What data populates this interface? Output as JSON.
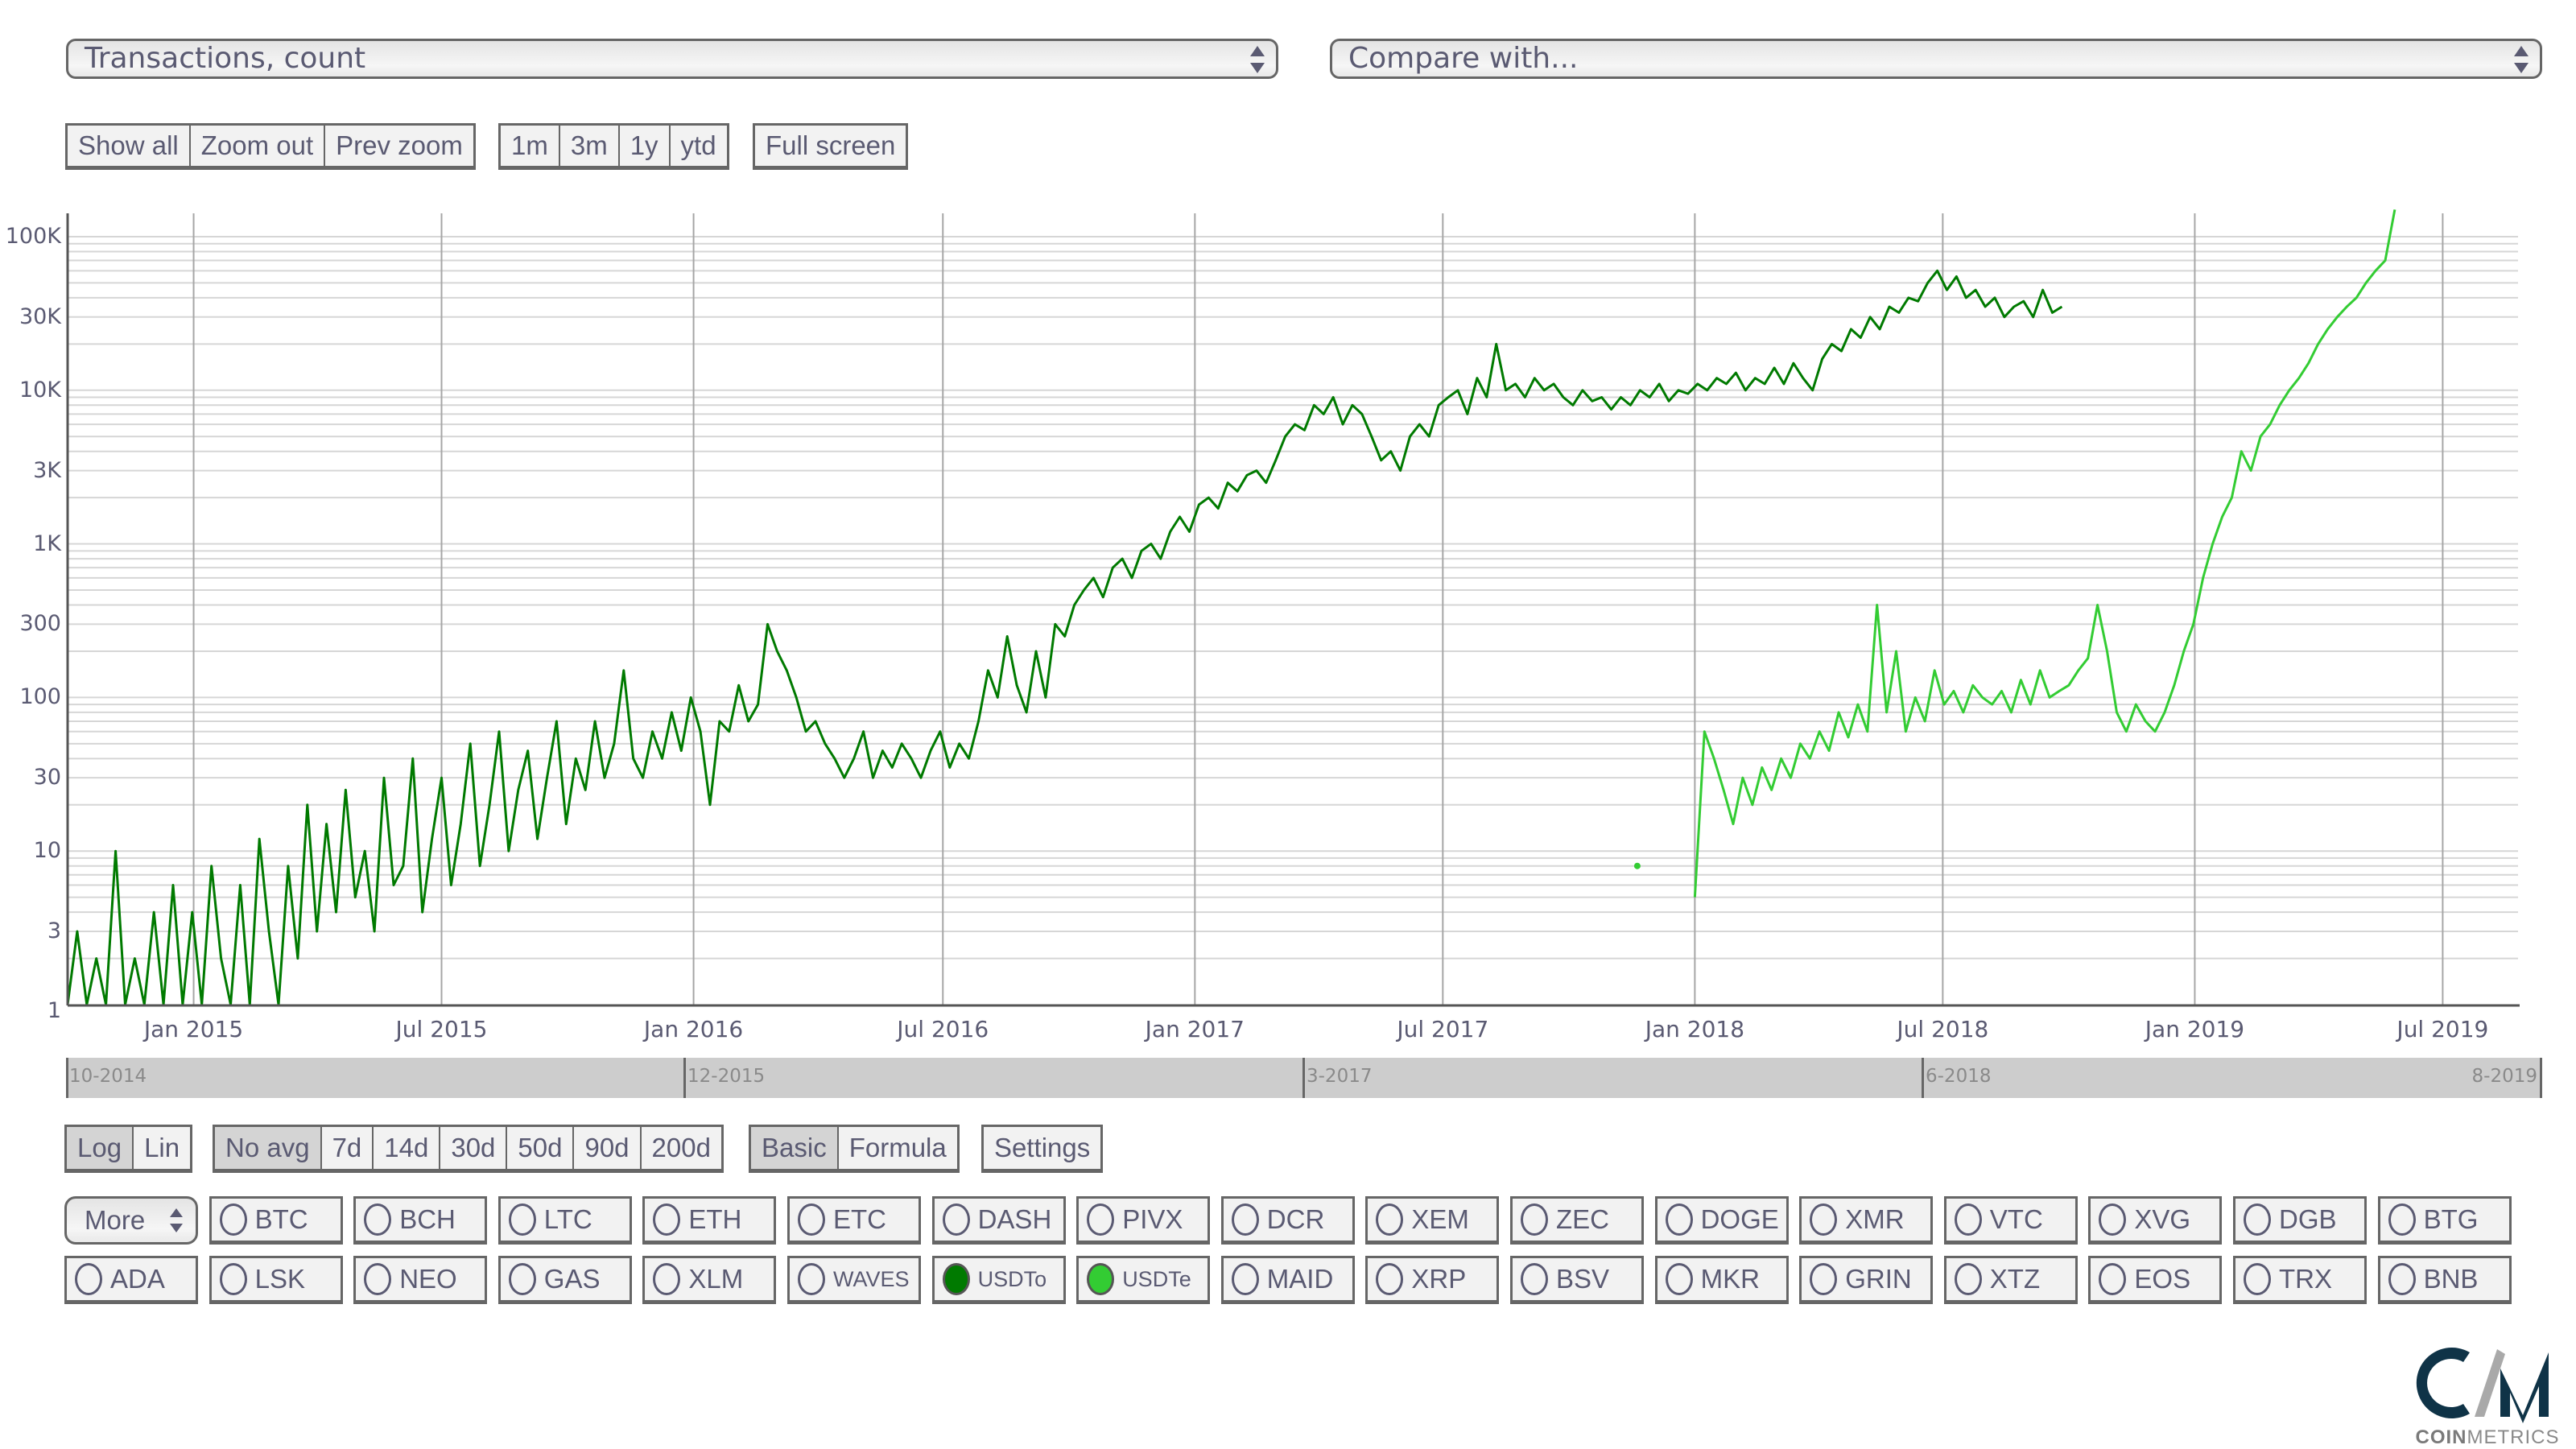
{
  "header": {
    "metric_select": "Transactions, count",
    "compare_select": "Compare with..."
  },
  "zoom_buttons": [
    "Show all",
    "Zoom out",
    "Prev zoom"
  ],
  "range_buttons": [
    "1m",
    "3m",
    "1y",
    "ytd"
  ],
  "fullscreen_button": "Full screen",
  "scale_buttons": [
    {
      "label": "Log",
      "active": true
    },
    {
      "label": "Lin",
      "active": false
    }
  ],
  "avg_buttons": [
    {
      "label": "No avg",
      "active": true
    },
    {
      "label": "7d",
      "active": false
    },
    {
      "label": "14d",
      "active": false
    },
    {
      "label": "30d",
      "active": false
    },
    {
      "label": "50d",
      "active": false
    },
    {
      "label": "90d",
      "active": false
    },
    {
      "label": "200d",
      "active": false
    }
  ],
  "mode_buttons": [
    {
      "label": "Basic",
      "active": true
    },
    {
      "label": "Formula",
      "active": false
    }
  ],
  "settings_button": "Settings",
  "more_select": "More",
  "coins_row1": [
    {
      "label": "BTC",
      "selected": false
    },
    {
      "label": "BCH",
      "selected": false
    },
    {
      "label": "LTC",
      "selected": false
    },
    {
      "label": "ETH",
      "selected": false
    },
    {
      "label": "ETC",
      "selected": false
    },
    {
      "label": "DASH",
      "selected": false
    },
    {
      "label": "PIVX",
      "selected": false
    },
    {
      "label": "DCR",
      "selected": false
    },
    {
      "label": "XEM",
      "selected": false
    },
    {
      "label": "ZEC",
      "selected": false
    },
    {
      "label": "DOGE",
      "selected": false
    },
    {
      "label": "XMR",
      "selected": false
    },
    {
      "label": "VTC",
      "selected": false
    },
    {
      "label": "XVG",
      "selected": false
    },
    {
      "label": "DGB",
      "selected": false
    },
    {
      "label": "BTG",
      "selected": false
    }
  ],
  "coins_row2": [
    {
      "label": "ADA",
      "selected": false
    },
    {
      "label": "LSK",
      "selected": false
    },
    {
      "label": "NEO",
      "selected": false
    },
    {
      "label": "GAS",
      "selected": false
    },
    {
      "label": "XLM",
      "selected": false
    },
    {
      "label": "WAVES",
      "selected": false
    },
    {
      "label": "USDTo",
      "selected": true,
      "color": "#007a00"
    },
    {
      "label": "USDTe",
      "selected": true,
      "color": "#33cc33"
    },
    {
      "label": "MAID",
      "selected": false
    },
    {
      "label": "XRP",
      "selected": false
    },
    {
      "label": "BSV",
      "selected": false
    },
    {
      "label": "MKR",
      "selected": false
    },
    {
      "label": "GRIN",
      "selected": false
    },
    {
      "label": "XTZ",
      "selected": false
    },
    {
      "label": "EOS",
      "selected": false
    },
    {
      "label": "TRX",
      "selected": false
    },
    {
      "label": "BNB",
      "selected": false
    }
  ],
  "navigator": {
    "labels": [
      "10-2014",
      "12-2015",
      "3-2017",
      "6-2018",
      "8-2019"
    ]
  },
  "logo": {
    "bold": "COIN",
    "light": "METRICS"
  },
  "chart_data": {
    "type": "line",
    "title": "Transactions, count",
    "xlabel": "",
    "ylabel": "",
    "y_scale": "log",
    "ylim": [
      1,
      150000
    ],
    "xlim": [
      "2014-10-01",
      "2019-08-25"
    ],
    "grid": true,
    "y_ticks": [
      {
        "value": 1,
        "label": "1"
      },
      {
        "value": 3,
        "label": "3"
      },
      {
        "value": 10,
        "label": "10"
      },
      {
        "value": 30,
        "label": "30"
      },
      {
        "value": 100,
        "label": "100"
      },
      {
        "value": 300,
        "label": "300"
      },
      {
        "value": 1000,
        "label": "1K"
      },
      {
        "value": 3000,
        "label": "3K"
      },
      {
        "value": 10000,
        "label": "10K"
      },
      {
        "value": 30000,
        "label": "30K"
      },
      {
        "value": 100000,
        "label": "100K"
      }
    ],
    "x_ticks": [
      {
        "date": "2015-01-01",
        "label": "Jan 2015"
      },
      {
        "date": "2015-07-01",
        "label": "Jul 2015"
      },
      {
        "date": "2016-01-01",
        "label": "Jan 2016"
      },
      {
        "date": "2016-07-01",
        "label": "Jul 2016"
      },
      {
        "date": "2017-01-01",
        "label": "Jan 2017"
      },
      {
        "date": "2017-07-01",
        "label": "Jul 2017"
      },
      {
        "date": "2018-01-01",
        "label": "Jan 2018"
      },
      {
        "date": "2018-07-01",
        "label": "Jul 2018"
      },
      {
        "date": "2019-01-01",
        "label": "Jan 2019"
      },
      {
        "date": "2019-07-01",
        "label": "Jul 2019"
      }
    ],
    "legend": "none",
    "series": [
      {
        "name": "USDTo",
        "color": "#007a00",
        "x_start": "2014-10-01",
        "step_days": 7,
        "values": [
          1,
          3,
          1,
          2,
          1,
          10,
          1,
          2,
          1,
          4,
          1,
          6,
          1,
          4,
          1,
          8,
          2,
          1,
          6,
          1,
          12,
          3,
          1,
          8,
          2,
          20,
          3,
          15,
          4,
          25,
          5,
          10,
          3,
          30,
          6,
          8,
          40,
          4,
          12,
          30,
          6,
          15,
          50,
          8,
          20,
          60,
          10,
          25,
          45,
          12,
          30,
          70,
          15,
          40,
          25,
          70,
          30,
          50,
          150,
          40,
          30,
          60,
          40,
          80,
          45,
          100,
          60,
          20,
          70,
          60,
          120,
          70,
          90,
          300,
          200,
          150,
          100,
          60,
          70,
          50,
          40,
          30,
          40,
          60,
          30,
          45,
          35,
          50,
          40,
          30,
          45,
          60,
          35,
          50,
          40,
          70,
          150,
          100,
          250,
          120,
          80,
          200,
          100,
          300,
          250,
          400,
          500,
          600,
          450,
          700,
          800,
          600,
          900,
          1000,
          800,
          1200,
          1500,
          1200,
          1800,
          2000,
          1700,
          2500,
          2200,
          2800,
          3000,
          2500,
          3500,
          5000,
          6000,
          5500,
          8000,
          7000,
          9000,
          6000,
          8000,
          7000,
          5000,
          3500,
          4000,
          3000,
          5000,
          6000,
          5000,
          8000,
          9000,
          10000,
          7000,
          12000,
          9000,
          20000,
          10000,
          11000,
          9000,
          12000,
          10000,
          11000,
          9000,
          8000,
          10000,
          8500,
          9000,
          7500,
          9000,
          8000,
          10000,
          9000,
          11000,
          8500,
          10000,
          9500,
          11000,
          10000,
          12000,
          11000,
          13000,
          10000,
          12000,
          11000,
          14000,
          11000,
          15000,
          12000,
          10000,
          16000,
          20000,
          18000,
          25000,
          22000,
          30000,
          25000,
          35000,
          32000,
          40000,
          38000,
          50000,
          60000,
          45000,
          55000,
          40000,
          45000,
          35000,
          40000,
          30000,
          35000,
          38000,
          30000,
          45000,
          32000,
          35000
        ]
      },
      {
        "name": "USDTe",
        "color": "#33cc33",
        "x_start": "2017-11-20",
        "step_days": 7,
        "values": [
          8,
          null,
          null,
          null,
          null,
          null,
          5,
          60,
          40,
          25,
          15,
          30,
          20,
          35,
          25,
          40,
          30,
          50,
          40,
          60,
          45,
          80,
          55,
          90,
          60,
          400,
          80,
          200,
          60,
          100,
          70,
          150,
          90,
          110,
          80,
          120,
          100,
          90,
          110,
          80,
          130,
          90,
          150,
          100,
          110,
          120,
          150,
          180,
          400,
          200,
          80,
          60,
          90,
          70,
          60,
          80,
          120,
          200,
          300,
          600,
          1000,
          1500,
          2000,
          4000,
          3000,
          5000,
          6000,
          8000,
          10000,
          12000,
          15000,
          20000,
          25000,
          30000,
          35000,
          40000,
          50000,
          60000,
          70000,
          150000
        ]
      }
    ]
  }
}
